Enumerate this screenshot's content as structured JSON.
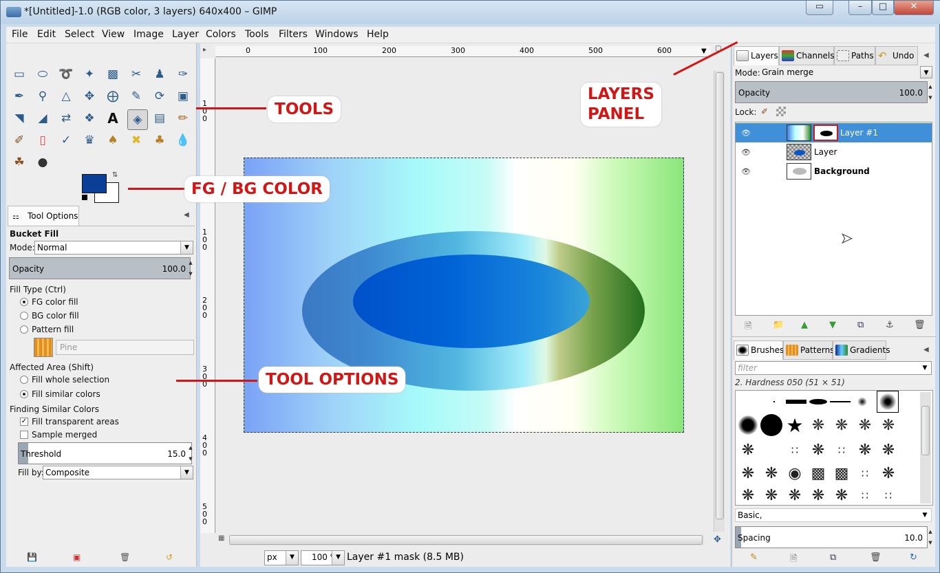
{
  "window": {
    "title": "*[Untitled]-1.0 (RGB color, 3 layers) 640x400 – GIMP",
    "buttons": [
      "▭",
      "–",
      "□",
      "✕"
    ]
  },
  "menu": [
    "File",
    "Edit",
    "Select",
    "View",
    "Image",
    "Layer",
    "Colors",
    "Tools",
    "Filters",
    "Windows",
    "Help"
  ],
  "annotations": {
    "tools": "TOOLS",
    "fgbg": "FG / BG COLOR",
    "tool_options": "TOOL OPTIONS",
    "layers_panel_1": "LAYERS",
    "layers_panel_2": "PANEL"
  },
  "tool_options": {
    "tab_label": "Tool Options",
    "tool_name": "Bucket Fill",
    "mode_label": "Mode:",
    "mode_value": "Normal",
    "opacity_label": "Opacity",
    "opacity_value": "100.0",
    "fill_type_label": "Fill Type  (Ctrl)",
    "fill_fg": "FG color fill",
    "fill_bg": "BG color fill",
    "fill_pattern": "Pattern fill",
    "pattern_name": "Pine",
    "affected_label": "Affected Area  (Shift)",
    "fill_whole": "Fill whole selection",
    "fill_similar": "Fill similar colors",
    "finding_label": "Finding Similar Colors",
    "fill_transparent": "Fill transparent areas",
    "sample_merged": "Sample merged",
    "threshold_label": "Threshold",
    "threshold_value": "15.0",
    "fillby_label": "Fill by:",
    "fillby_value": "Composite"
  },
  "ruler": {
    "top": [
      "0",
      "100",
      "200",
      "300",
      "400",
      "500",
      "600"
    ],
    "left": [
      "1\n0\n0",
      "1\n0\n0",
      "2\n0\n0",
      "3\n0\n0",
      "4\n0\n0",
      "5\n0\n0"
    ]
  },
  "statusbar": {
    "unit": "px",
    "zoom": "100 %",
    "message": "Layer #1 mask (8.5 MB)"
  },
  "layers_panel": {
    "tabs": [
      "Layers",
      "Channels",
      "Paths",
      "Undo"
    ],
    "mode_label": "Mode:",
    "mode_value": "Grain merge",
    "opacity_label": "Opacity",
    "opacity_value": "100.0",
    "lock_label": "Lock:",
    "layers": [
      {
        "name": "Layer #1",
        "selected": true
      },
      {
        "name": "Layer",
        "selected": false
      },
      {
        "name": "Background",
        "selected": false
      }
    ]
  },
  "brushes_panel": {
    "tabs": [
      "Brushes",
      "Patterns",
      "Gradients"
    ],
    "filter_placeholder": "filter",
    "brush_name": "2. Hardness 050 (51 × 51)",
    "preset": "Basic,",
    "spacing_label": "Spacing",
    "spacing_value": "10.0"
  },
  "colors": {
    "fg": "#0b3e96",
    "bg": "#ffffff",
    "annotation_red": "#d11616",
    "selection_blue": "#3f8fd9"
  }
}
